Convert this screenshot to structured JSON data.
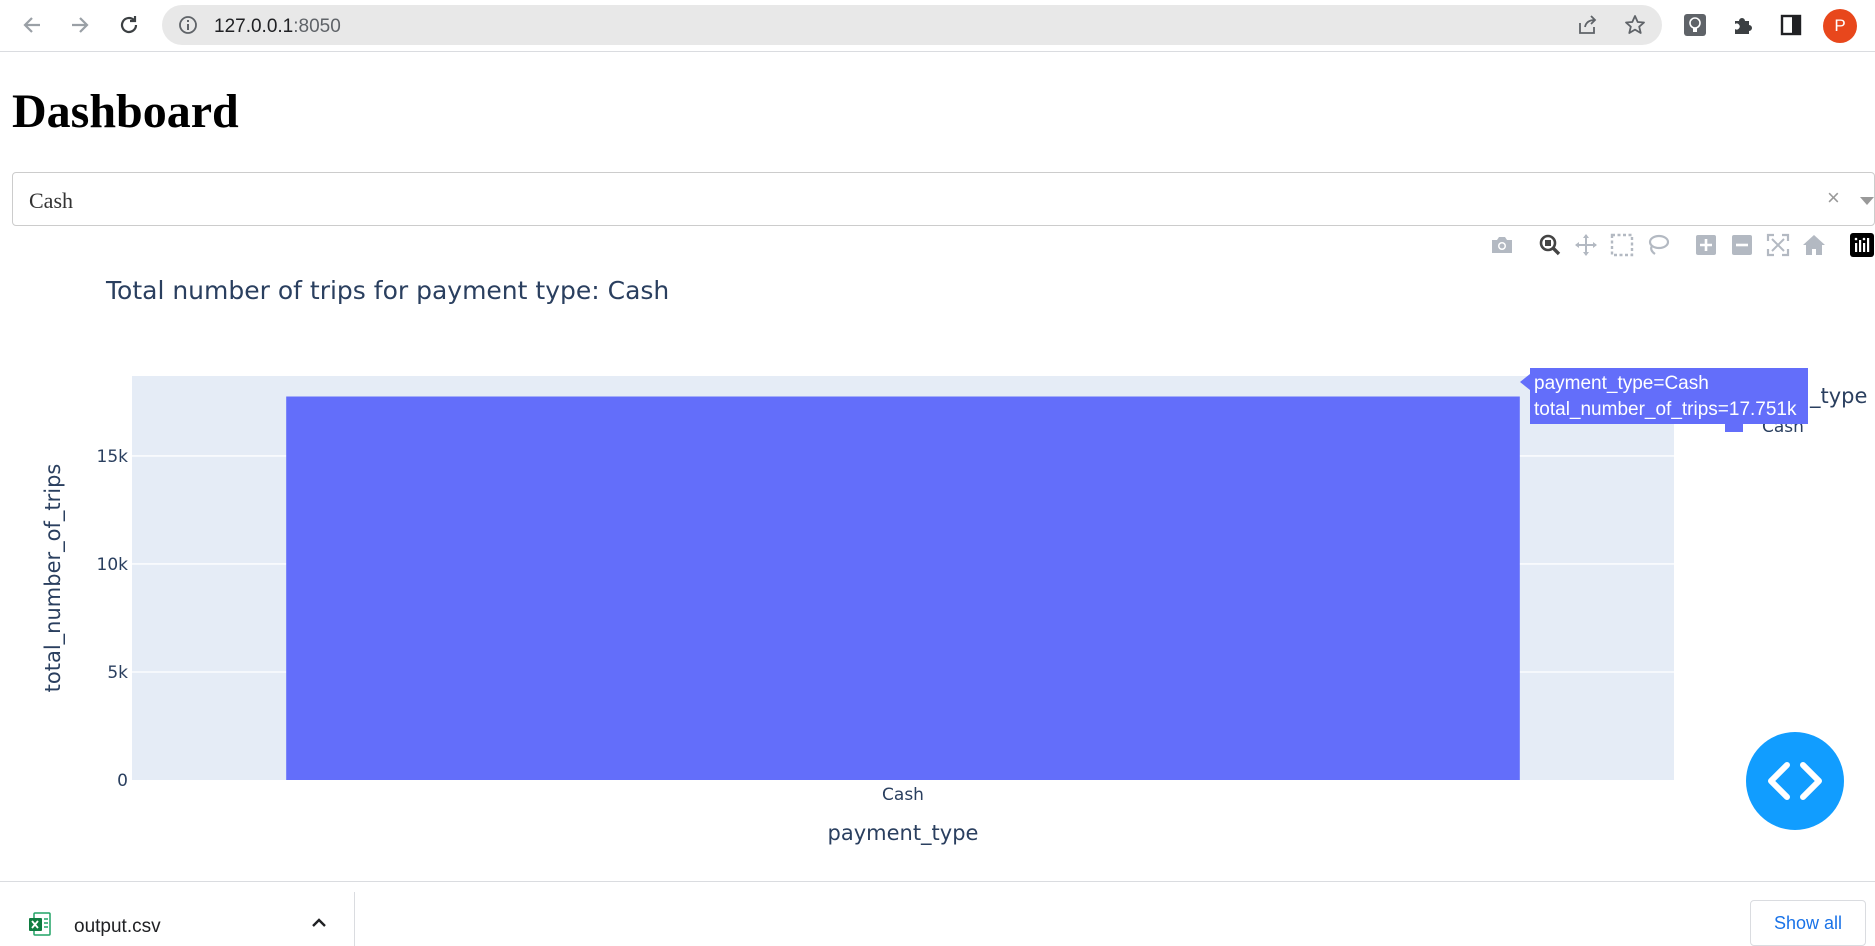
{
  "browser": {
    "url_host": "127.0.0.1",
    "url_port": ":8050",
    "avatar_letter": "P"
  },
  "page": {
    "title": "Dashboard"
  },
  "dropdown": {
    "selected": "Cash",
    "clear_symbol": "×"
  },
  "modebar": {
    "buttons": [
      "camera-icon",
      "zoom-icon",
      "pan-icon",
      "box-select-icon",
      "lasso-icon",
      "zoom-in-icon",
      "zoom-out-icon",
      "autoscale-icon",
      "reset-axes-icon",
      "plotly-logo-icon"
    ]
  },
  "chart_data": {
    "type": "bar",
    "title": "Total number of trips for payment type: Cash",
    "xlabel": "payment_type",
    "ylabel": "total_number_of_trips",
    "categories": [
      "Cash"
    ],
    "series": [
      {
        "name": "Cash",
        "values": [
          17751
        ],
        "color": "#636efa"
      }
    ],
    "ylim": [
      0,
      18700
    ],
    "yticks": [
      0,
      5000,
      10000,
      15000
    ],
    "ytick_labels": [
      "0",
      "5k",
      "10k",
      "15k"
    ],
    "legend_title": "payment_type",
    "legend_title_visible": "_type",
    "legend_placement": "top-right",
    "grid": true,
    "plot_bg": "#e5ecf6",
    "hover": {
      "line1": "payment_type=Cash",
      "line2": "total_number_of_trips=17.751k"
    }
  },
  "downloads": {
    "file_name": "output.csv",
    "show_all": "Show all"
  }
}
